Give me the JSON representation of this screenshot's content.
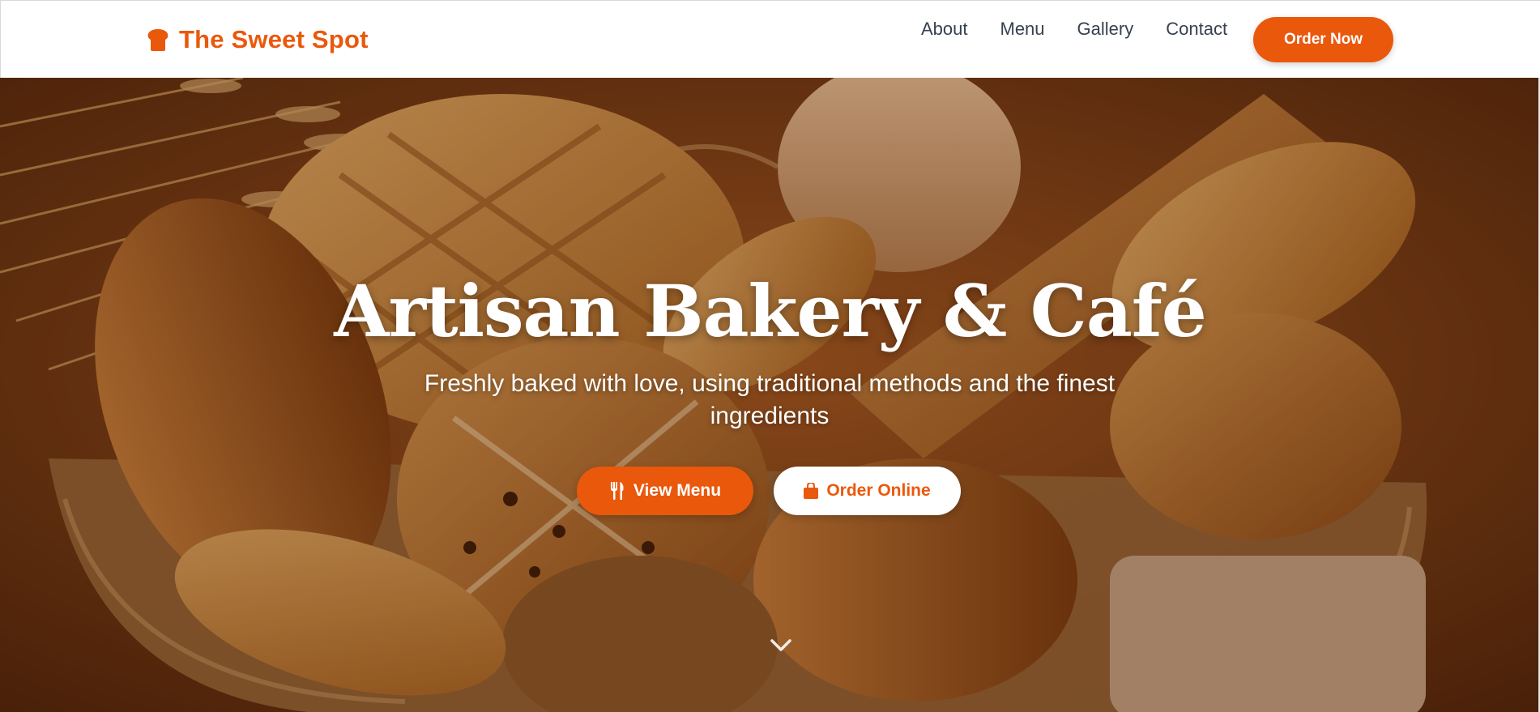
{
  "brand": {
    "name": "The Sweet Spot",
    "icon": "bread-icon"
  },
  "nav": {
    "items": [
      {
        "label": "About"
      },
      {
        "label": "Menu"
      },
      {
        "label": "Gallery"
      },
      {
        "label": "Contact"
      }
    ],
    "cta_label": "Order Now"
  },
  "hero": {
    "title": "Artisan Bakery & Café",
    "subtitle": "Freshly baked with love, using traditional methods and the finest ingredients",
    "primary_button": {
      "label": "View Menu",
      "icon": "utensils-icon"
    },
    "secondary_button": {
      "label": "Order Online",
      "icon": "shopping-bag-icon"
    },
    "scroll_icon": "chevron-down-icon",
    "background": "bread-basket-photo"
  },
  "colors": {
    "accent": "#ea580c",
    "nav_text": "#374151",
    "hero_text": "#ffffff"
  }
}
